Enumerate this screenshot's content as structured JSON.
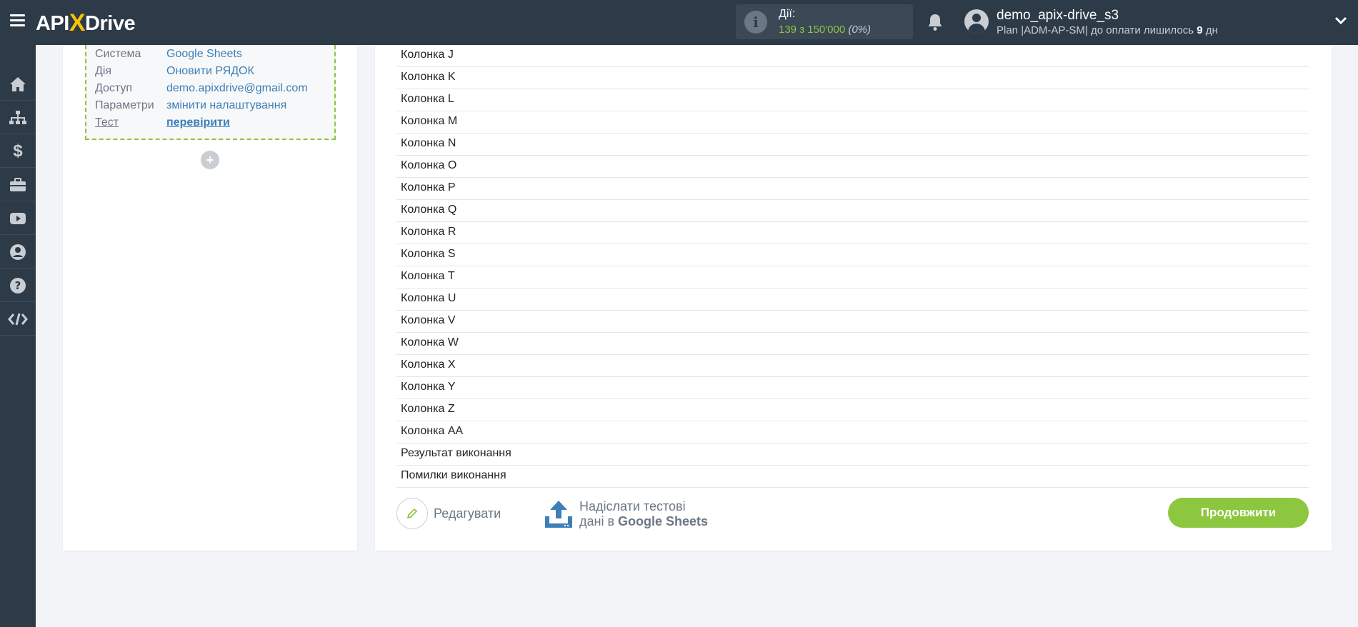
{
  "header": {
    "logo": {
      "api": "API",
      "x": "X",
      "drive": "Drive"
    },
    "actions": {
      "label": "Дії:",
      "count": "139 з 150'000",
      "pct": "(0%)"
    },
    "user": {
      "name": "demo_apix-drive_s3",
      "plan_prefix": "Plan |ADM-AP-SM| до оплати лишилось ",
      "days": "9",
      "plan_suffix": " дн"
    }
  },
  "sidebar": {
    "items": [
      "home-icon",
      "sitemap-icon",
      "dollar-icon",
      "briefcase-icon",
      "youtube-icon",
      "user-circle-icon",
      "question-icon",
      "code-icon"
    ]
  },
  "destination": {
    "rows": [
      {
        "key": "Система",
        "value": "Google Sheets"
      },
      {
        "key": "Дія",
        "value": "Оновити РЯДОК"
      },
      {
        "key": "Доступ",
        "value": "demo.apixdrive@gmail.com"
      },
      {
        "key": "Параметри",
        "value": "змінити налаштування"
      },
      {
        "key": "Тест",
        "value": "перевірити"
      }
    ],
    "add_label": "+"
  },
  "fields": [
    "Колонка J",
    "Колонка K",
    "Колонка L",
    "Колонка M",
    "Колонка N",
    "Колонка O",
    "Колонка P",
    "Колонка Q",
    "Колонка R",
    "Колонка S",
    "Колонка T",
    "Колонка U",
    "Колонка V",
    "Колонка W",
    "Колонка X",
    "Колонка Y",
    "Колонка Z",
    "Колонка AA",
    "Результат виконання",
    "Помилки виконання"
  ],
  "footer": {
    "edit_label": "Редагувати",
    "send_line1": "Надіслати тестові",
    "send_line2_prefix": "дані в ",
    "send_line2_bold": "Google Sheets",
    "continue_label": "Продовжити"
  },
  "colors": {
    "accent": "#8dc63f",
    "header_bg": "#2d3a48",
    "link": "#3d7fb8"
  }
}
